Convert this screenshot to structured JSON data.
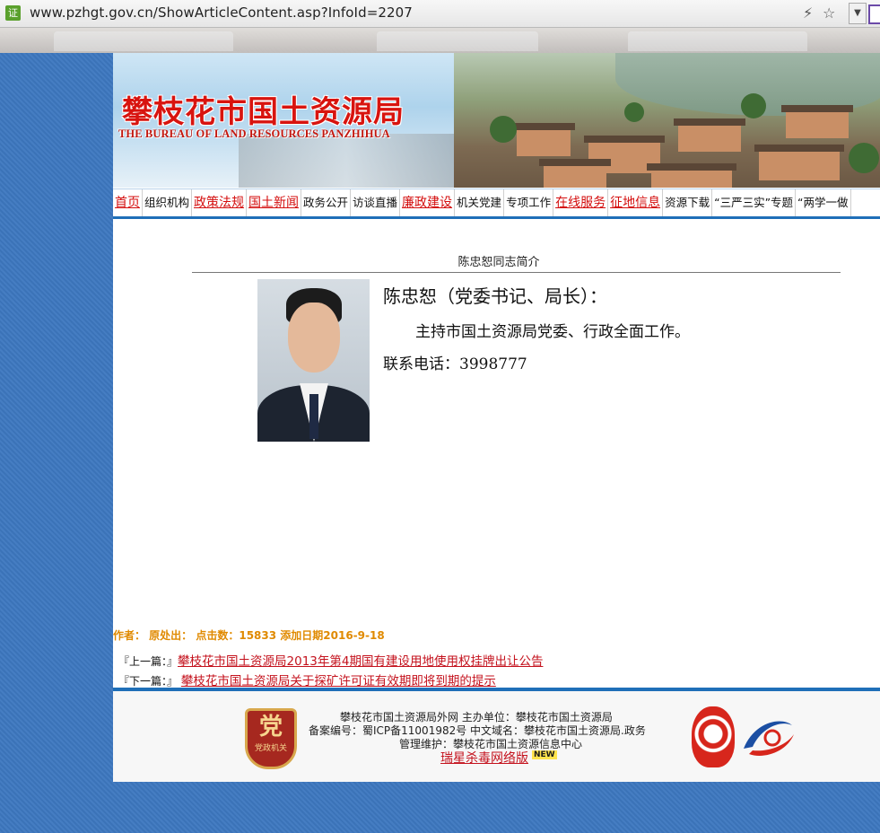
{
  "browser": {
    "cert_label": "证",
    "url": "www.pzhgt.gov.cn/ShowArticleContent.asp?InfoId=2207"
  },
  "header": {
    "title_cn": "攀枝花市国土资源局",
    "title_en": "THE BUREAU OF LAND RESOURCES PANZHIHUA"
  },
  "nav": {
    "items": [
      {
        "label": "首页",
        "style": "red"
      },
      {
        "label": "组织机构",
        "style": "plain"
      },
      {
        "label": "政策法规",
        "style": "red"
      },
      {
        "label": "国土新闻",
        "style": "red"
      },
      {
        "label": "政务公开",
        "style": "plain"
      },
      {
        "label": "访谈直播",
        "style": "plain"
      },
      {
        "label": "廉政建设",
        "style": "red"
      },
      {
        "label": "机关党建",
        "style": "plain"
      },
      {
        "label": "专项工作",
        "style": "plain"
      },
      {
        "label": "在线服务",
        "style": "red"
      },
      {
        "label": "征地信息",
        "style": "red"
      },
      {
        "label": "资源下载",
        "style": "plain"
      },
      {
        "label": "“三严三实”专题",
        "style": "plain"
      },
      {
        "label": "“两学一做",
        "style": "plain"
      }
    ]
  },
  "article": {
    "title": "陈忠恕同志简介",
    "name_line": "陈忠恕（党委书记、局长）：",
    "duty": "主持市国土资源局党委、行政全面工作。",
    "phone": "联系电话：3998777",
    "meta": "作者：  原处出：  点击数：15833  添加日期2016-9-18",
    "prev_prefix": "『上一篇：』",
    "prev_title": "攀枝花市国土资源局2013年第4期国有建设用地使用权挂牌出让公告",
    "next_prefix": "『下一篇：』",
    "next_title": "攀枝花市国土资源局关于探矿许可证有效期即将到期的提示"
  },
  "footer": {
    "line1": "攀枝花市国土资源局外网      主办单位：攀枝花市国土资源局",
    "line2": "备案编号：蜀ICP备11001982号      中文域名：攀枝花市国土资源局.政务",
    "line3": "管理维护：攀枝花市国土资源信息中心",
    "antivirus": "瑞星杀毒网络版",
    "new_badge": "NEW",
    "badge_glyph": "党",
    "badge_caption": "党政机关"
  },
  "colors": {
    "page_bg": "#3d78c0",
    "accent_blue": "#1f6fb8",
    "title_red": "#d8140f",
    "link_red": "#c4121d",
    "meta_orange": "#e08a00"
  }
}
